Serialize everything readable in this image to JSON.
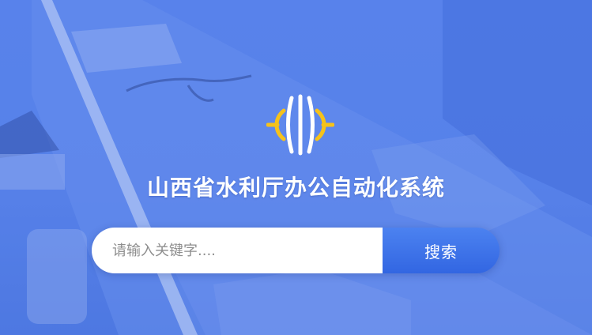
{
  "header": {
    "title": "山西省水利厅办公自动化系统"
  },
  "logo": {
    "icon": "water-resources-logo-icon"
  },
  "search": {
    "placeholder": "请输入关键字....",
    "value": "",
    "button_label": "搜索"
  },
  "colors": {
    "background_blue": "#5A84EC",
    "button_blue": "#3A6FE6",
    "logo_white": "#FFFFFF",
    "logo_yellow": "#F6C21A",
    "title_text": "#FFFFFF"
  }
}
